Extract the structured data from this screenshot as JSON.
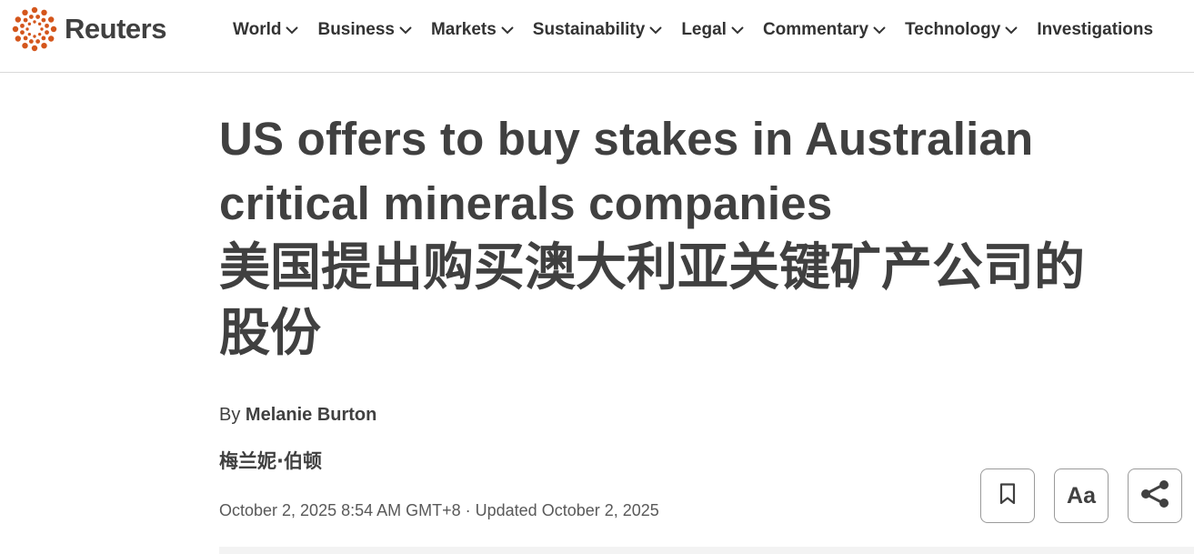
{
  "header": {
    "logo_text": "Reuters",
    "logo_icon": "reuters-dot-ring-icon",
    "brand_color": "#d4561c",
    "nav": [
      {
        "label": "World",
        "has_dropdown": true
      },
      {
        "label": "Business",
        "has_dropdown": true
      },
      {
        "label": "Markets",
        "has_dropdown": true
      },
      {
        "label": "Sustainability",
        "has_dropdown": true
      },
      {
        "label": "Legal",
        "has_dropdown": true
      },
      {
        "label": "Commentary",
        "has_dropdown": true
      },
      {
        "label": "Technology",
        "has_dropdown": true
      },
      {
        "label": "Investigations",
        "has_dropdown": false
      }
    ]
  },
  "article": {
    "title_en_line1": "US offers to buy stakes in Australian",
    "title_en_line2": "critical minerals companies",
    "title_zh_line1": "美国提出购买澳大利亚关键矿产公司的",
    "title_zh_line2": "股份",
    "byline_prefix": "By",
    "author": "Melanie Burton",
    "author_zh": "梅兰妮·伯顿",
    "dateline": "October 2, 2025 8:54 AM GMT+8 · Updated October 2, 2025"
  },
  "tools": {
    "bookmark_icon": "bookmark-icon",
    "text_size_label": "Aa",
    "share_icon": "share-icon"
  }
}
